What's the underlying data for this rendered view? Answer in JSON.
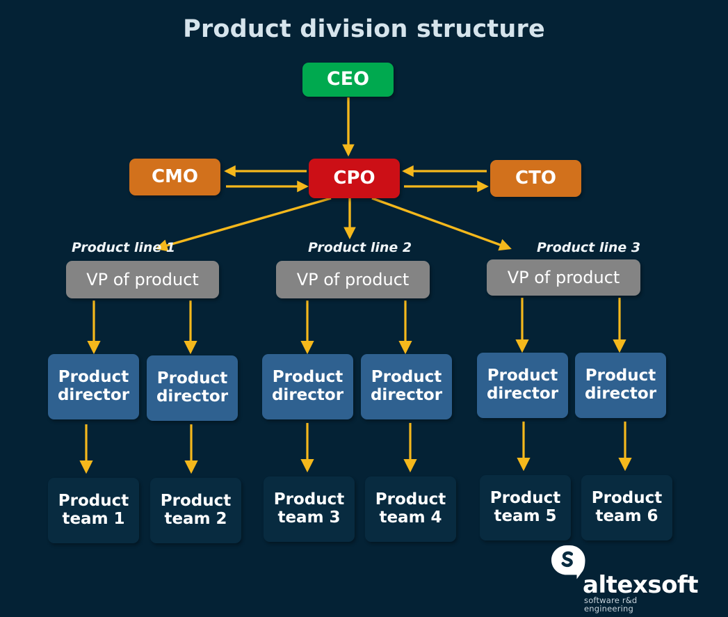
{
  "page": {
    "title": "Product division structure",
    "background_color": "#042235",
    "title_color": "#d6e4ec"
  },
  "colors": {
    "ceo": "#00a94f",
    "exec_orange": "#d2711c",
    "exec_red": "#cc0f16",
    "vp": "#848484",
    "director": "#2f6190",
    "team": "#082b40",
    "arrow": "#f5b81c",
    "text": "#ffffff"
  },
  "chart_data": {
    "type": "diagram",
    "title": "Product division structure",
    "nodes": [
      {
        "id": "ceo",
        "label": "CEO",
        "level": 0,
        "color": "#00a94f"
      },
      {
        "id": "cmo",
        "label": "CMO",
        "level": 1,
        "color": "#d2711c"
      },
      {
        "id": "cpo",
        "label": "CPO",
        "level": 1,
        "color": "#cc0f16"
      },
      {
        "id": "cto",
        "label": "CTO",
        "level": 1,
        "color": "#d2711c"
      },
      {
        "id": "vp1",
        "label": "VP of product",
        "level": 2,
        "color": "#848484"
      },
      {
        "id": "vp2",
        "label": "VP of product",
        "level": 2,
        "color": "#848484"
      },
      {
        "id": "vp3",
        "label": "VP of product",
        "level": 2,
        "color": "#848484"
      },
      {
        "id": "dir1",
        "label": "Product\ndirector",
        "level": 3,
        "color": "#2f6190"
      },
      {
        "id": "dir2",
        "label": "Product\ndirector",
        "level": 3,
        "color": "#2f6190"
      },
      {
        "id": "dir3",
        "label": "Product\ndirector",
        "level": 3,
        "color": "#2f6190"
      },
      {
        "id": "dir4",
        "label": "Product\ndirector",
        "level": 3,
        "color": "#2f6190"
      },
      {
        "id": "dir5",
        "label": "Product\ndirector",
        "level": 3,
        "color": "#2f6190"
      },
      {
        "id": "dir6",
        "label": "Product\ndirector",
        "level": 3,
        "color": "#2f6190"
      },
      {
        "id": "team1",
        "label": "Product\nteam 1",
        "level": 4,
        "color": "#082b40"
      },
      {
        "id": "team2",
        "label": "Product\nteam 2",
        "level": 4,
        "color": "#082b40"
      },
      {
        "id": "team3",
        "label": "Product\nteam 3",
        "level": 4,
        "color": "#082b40"
      },
      {
        "id": "team4",
        "label": "Product\nteam 4",
        "level": 4,
        "color": "#082b40"
      },
      {
        "id": "team5",
        "label": "Product\nteam 5",
        "level": 4,
        "color": "#082b40"
      },
      {
        "id": "team6",
        "label": "Product\nteam 6",
        "level": 4,
        "color": "#082b40"
      }
    ],
    "edges": [
      {
        "from": "ceo",
        "to": "cpo",
        "kind": "down"
      },
      {
        "from": "cpo",
        "to": "cmo",
        "kind": "bidirectional"
      },
      {
        "from": "cpo",
        "to": "cto",
        "kind": "bidirectional"
      },
      {
        "from": "cpo",
        "to": "vp1",
        "kind": "diagonal-left"
      },
      {
        "from": "cpo",
        "to": "vp2",
        "kind": "down"
      },
      {
        "from": "cpo",
        "to": "vp3",
        "kind": "diagonal-right"
      },
      {
        "from": "vp1",
        "to": "dir1",
        "kind": "down"
      },
      {
        "from": "vp1",
        "to": "dir2",
        "kind": "down"
      },
      {
        "from": "vp2",
        "to": "dir3",
        "kind": "down"
      },
      {
        "from": "vp2",
        "to": "dir4",
        "kind": "down"
      },
      {
        "from": "vp3",
        "to": "dir5",
        "kind": "down"
      },
      {
        "from": "vp3",
        "to": "dir6",
        "kind": "down"
      },
      {
        "from": "dir1",
        "to": "team1",
        "kind": "down"
      },
      {
        "from": "dir2",
        "to": "team2",
        "kind": "down"
      },
      {
        "from": "dir3",
        "to": "team3",
        "kind": "down"
      },
      {
        "from": "dir4",
        "to": "team4",
        "kind": "down"
      },
      {
        "from": "dir5",
        "to": "team5",
        "kind": "down"
      },
      {
        "from": "dir6",
        "to": "team6",
        "kind": "down"
      }
    ],
    "group_labels": [
      "Product line 1",
      "Product line 2",
      "Product line 3"
    ]
  },
  "nodes": {
    "ceo": "CEO",
    "cmo": "CMO",
    "cpo": "CPO",
    "cto": "CTO",
    "vp1": "VP of product",
    "vp2": "VP of product",
    "vp3": "VP of product",
    "dir1": "Product\ndirector",
    "dir2": "Product\ndirector",
    "dir3": "Product\ndirector",
    "dir4": "Product\ndirector",
    "dir5": "Product\ndirector",
    "dir6": "Product\ndirector",
    "team1": "Product\nteam 1",
    "team2": "Product\nteam 2",
    "team3": "Product\nteam 3",
    "team4": "Product\nteam 4",
    "team5": "Product\nteam 5",
    "team6": "Product\nteam 6"
  },
  "group_labels": {
    "line1": "Product line 1",
    "line2": "Product line 2",
    "line3": "Product line 3"
  },
  "logo": {
    "wordmark": "altexsoft",
    "tagline": "software r&d engineering"
  }
}
